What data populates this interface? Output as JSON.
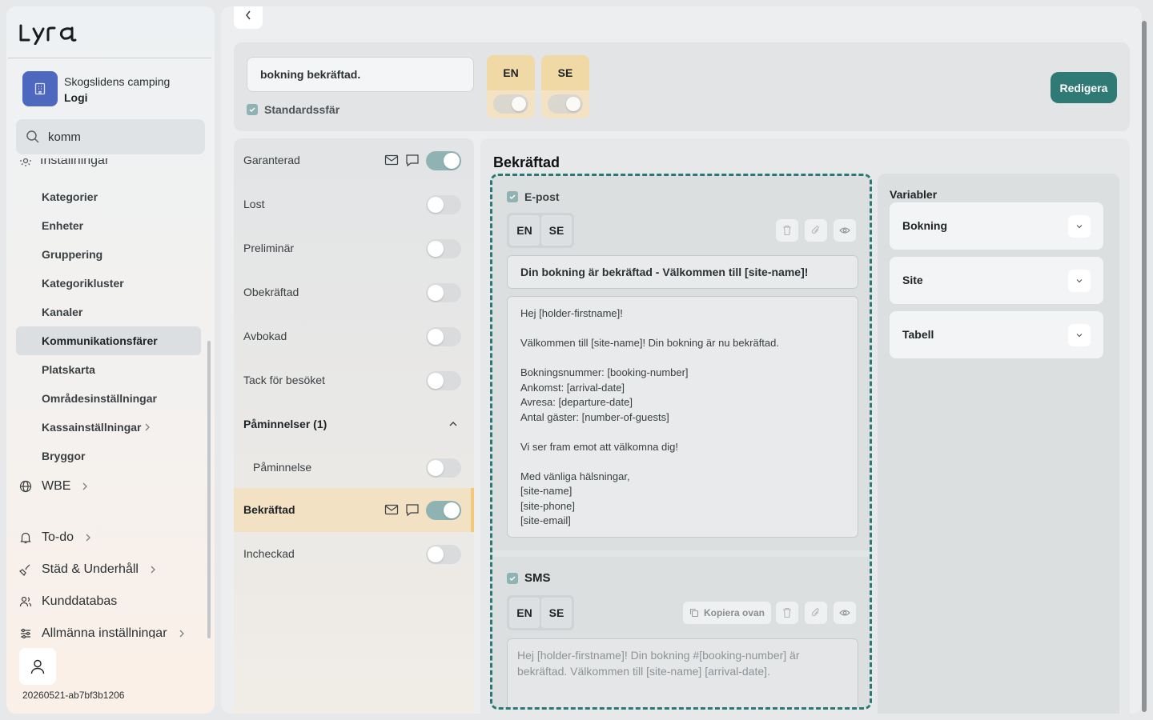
{
  "app": {
    "logo_text": "Lyra",
    "version": "20260521-ab7bf3b1206"
  },
  "org": {
    "name": "Skogslidens camping",
    "sub": "Logi"
  },
  "search": {
    "value": "komm"
  },
  "nav": {
    "partial_label": "Inställningar",
    "sub_items": [
      {
        "label": "Kategorier"
      },
      {
        "label": "Enheter"
      },
      {
        "label": "Gruppering"
      },
      {
        "label": "Kategorikluster"
      },
      {
        "label": "Kanaler"
      },
      {
        "label": "Kommunikationsfärer",
        "active": true
      },
      {
        "label": "Platskarta"
      },
      {
        "label": "Områdesinställningar"
      },
      {
        "label": "Kassainställningar",
        "has_children": true
      },
      {
        "label": "Bryggor"
      }
    ],
    "top_items": [
      {
        "label": "WBE",
        "icon": "globe-icon"
      },
      {
        "label": "To-do",
        "icon": "bell-icon"
      },
      {
        "label": "Städ & Underhåll",
        "icon": "broom-icon"
      },
      {
        "label": "Kunddatabas",
        "icon": "users-icon"
      },
      {
        "label": "Allmänna inställningar",
        "icon": "sliders-icon"
      }
    ]
  },
  "template": {
    "name_value": "bokning bekräftad.",
    "default_label": "Standardssfär",
    "languages": [
      {
        "code": "EN",
        "enabled": true
      },
      {
        "code": "SE",
        "enabled": true
      }
    ],
    "edit_label": "Redigera"
  },
  "statuses": [
    {
      "label": "Garanterad",
      "on": true,
      "icons": true
    },
    {
      "label": "Lost",
      "on": false
    },
    {
      "label": "Preliminär",
      "on": false
    },
    {
      "label": "Obekräftad",
      "on": false
    },
    {
      "label": "Avbokad",
      "on": false
    },
    {
      "label": "Tack för besöket",
      "on": false
    }
  ],
  "reminders": {
    "header": "Påminnelser (1)",
    "items": [
      {
        "label": "Påminnelse",
        "on": false
      }
    ]
  },
  "bottom_statuses": [
    {
      "label": "Bekräftad",
      "on": true,
      "icons": true,
      "active": true
    },
    {
      "label": "Incheckad",
      "on": false
    }
  ],
  "editor": {
    "title": "Bekräftad",
    "email": {
      "label": "E-post",
      "lang_tabs": [
        "EN",
        "SE"
      ],
      "subject": "Din bokning är bekräftad - Välkommen till [site-name]!",
      "body": "Hej [holder-firstname]!\n\nVälkommen till [site-name]! Din bokning är nu bekräftad.\n\nBokningsnummer: [booking-number]\nAnkomst: [arrival-date]\nAvresa: [departure-date]\nAntal gäster: [number-of-guests]\n\nVi ser fram emot att välkomna dig!\n\nMed vänliga hälsningar,\n[site-name]\n[site-phone]\n[site-email]"
    },
    "sms": {
      "label": "SMS",
      "lang_tabs": [
        "EN",
        "SE"
      ],
      "copy_label": "Kopiera ovan",
      "body": "Hej [holder-firstname]! Din bokning #[booking-number] är bekräftad. Välkommen till [site-name] [arrival-date]."
    }
  },
  "variables": {
    "title": "Variabler",
    "groups": [
      {
        "label": "Bokning"
      },
      {
        "label": "Site"
      },
      {
        "label": "Tabell"
      }
    ]
  },
  "colors": {
    "accent": "#2f7a74",
    "toggle_on": "#8fb3b3",
    "active_row": "#f3e1c4",
    "lang_card": "#f1d9a6",
    "org_icon": "#4e68c0"
  }
}
